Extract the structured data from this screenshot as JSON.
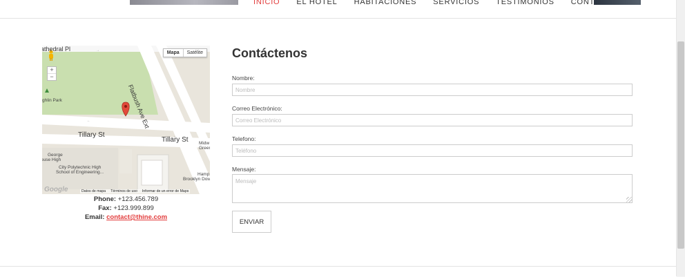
{
  "nav": {
    "items": [
      "INICIO",
      "EL HOTEL",
      "HABITACIONES",
      "SERVICIOS",
      "TESTIMONIOS",
      "CONTÁCTENOS"
    ],
    "active": "INICIO"
  },
  "map": {
    "map_button": "Mapa",
    "satellite_button": "Satélite",
    "zoom_in": "+",
    "zoom_out": "−",
    "streets": {
      "tillary_west": "Tillary St",
      "tillary_east": "Tillary St",
      "flatbush": "Flatbush Ave Ext",
      "cathedral": "athedral Pl"
    },
    "places": {
      "park": "ghlin Park",
      "george_line1": "George",
      "george_line2": "ouse High",
      "polytechnic_line1": "City Polytechnic High",
      "polytechnic_line2": "School of Engineering...",
      "midwood_line1": "Midw",
      "midwood_line2": "Green",
      "hampton": "Hamp",
      "brooklyn": "Brooklyn Dow"
    },
    "footer": {
      "data": "Datos de mapa",
      "terms": "Términos de uso",
      "report": "Informar de un error de Maps"
    },
    "logo": "Google"
  },
  "contact_info": {
    "phone_label": "Phone:",
    "phone": "+123.456.789",
    "fax_label": "Fax:",
    "fax": "+123.999.899",
    "email_label": "Email:",
    "email": "contact@thine.com"
  },
  "form": {
    "title": "Contáctenos",
    "name_label": "Nombre:",
    "name_placeholder": "Nombre",
    "email_label": "Correo Electrónico:",
    "email_placeholder": "Correo Electrónico",
    "phone_label": "Telefono:",
    "phone_placeholder": "Teléfono",
    "message_label": "Mensaje:",
    "message_placeholder": "Mensaje",
    "submit_label": "ENVIAR"
  },
  "colors": {
    "accent": "#e23a3a"
  }
}
